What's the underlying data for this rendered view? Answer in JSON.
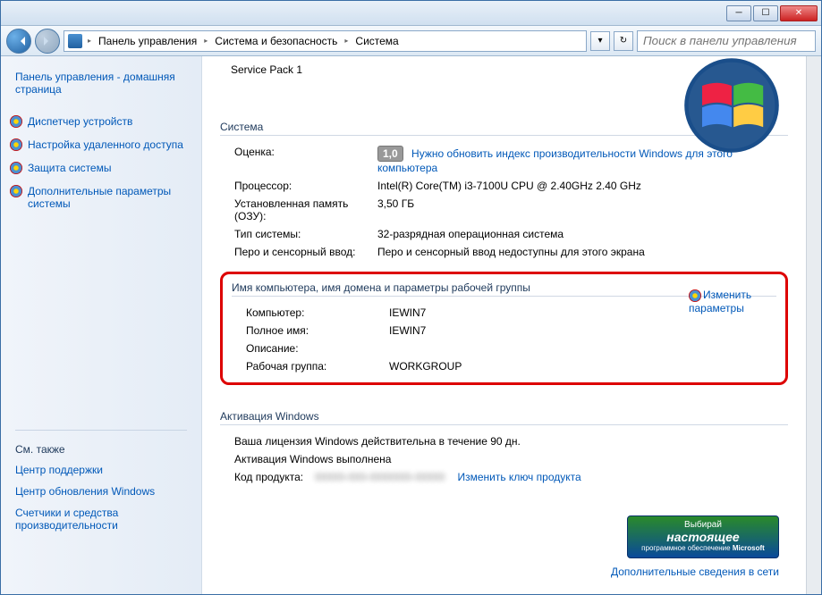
{
  "breadcrumb": {
    "root": "Панель управления",
    "mid": "Система и безопасность",
    "leaf": "Система"
  },
  "search": {
    "placeholder": "Поиск в панели управления"
  },
  "sidebar": {
    "home": "Панель управления - домашняя страница",
    "links": [
      "Диспетчер устройств",
      "Настройка удаленного доступа",
      "Защита системы",
      "Дополнительные параметры системы"
    ],
    "see_also": "См. также",
    "subs": [
      "Центр поддержки",
      "Центр обновления Windows",
      "Счетчики и средства производительности"
    ]
  },
  "content": {
    "service_pack": "Service Pack 1",
    "system_section": "Система",
    "rating_label": "Оценка:",
    "rating_value": "1,0",
    "rating_text": "Нужно обновить индекс производительности Windows для этого компьютера",
    "cpu_label": "Процессор:",
    "cpu_value": "Intel(R) Core(TM) i3-7100U CPU @ 2.40GHz   2.40 GHz",
    "ram_label": "Установленная память (ОЗУ):",
    "ram_value": "3,50 ГБ",
    "type_label": "Тип системы:",
    "type_value": "32-разрядная операционная система",
    "pen_label": "Перо и сенсорный ввод:",
    "pen_value": "Перо и сенсорный ввод недоступны для этого экрана",
    "name_section": "Имя компьютера, имя домена и параметры рабочей группы",
    "computer_label": "Компьютер:",
    "computer_value": "IEWIN7",
    "fullname_label": "Полное имя:",
    "fullname_value": "IEWIN7",
    "desc_label": "Описание:",
    "desc_value": "",
    "workgroup_label": "Рабочая группа:",
    "workgroup_value": "WORKGROUP",
    "change_link": "Изменить параметры",
    "activation_section": "Активация Windows",
    "license_text": "Ваша лицензия Windows действительна в течение 90 дн.",
    "activation_done": "Активация Windows выполнена",
    "product_key_label": "Код продукта:",
    "change_key": "Изменить ключ продукта",
    "ad_line1": "Выбирай",
    "ad_line2": "настоящее",
    "ad_line3": "программное обеспечение",
    "ad_brand": "Microsoft",
    "extra_info": "Дополнительные сведения в сети"
  }
}
